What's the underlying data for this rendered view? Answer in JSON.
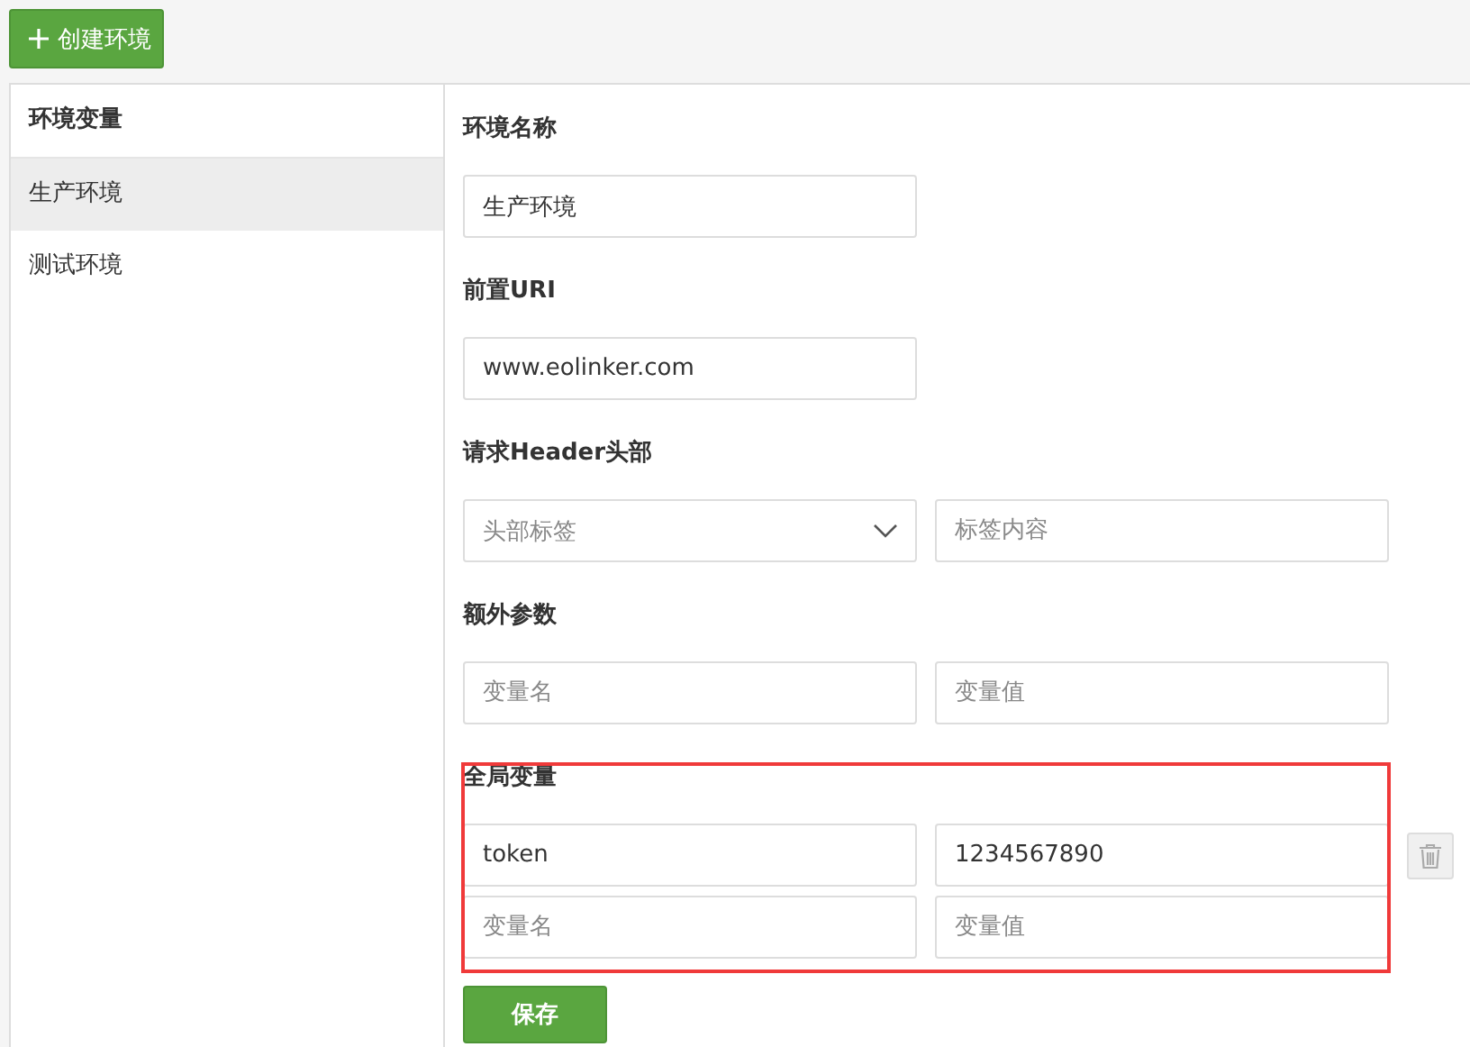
{
  "toolbar": {
    "create_button": "创建环境"
  },
  "sidebar": {
    "title": "环境变量",
    "items": [
      {
        "label": "生产环境",
        "selected": true
      },
      {
        "label": "测试环境",
        "selected": false
      }
    ]
  },
  "form": {
    "sections": [
      {
        "kind": "text",
        "label": "环境名称",
        "value": "生产环境"
      },
      {
        "kind": "text",
        "label": "前置URI",
        "value": "www.eolinker.com"
      },
      {
        "kind": "select-pair",
        "label": "请求Header头部",
        "select_placeholder": "头部标签",
        "placeholder": "标签内容"
      },
      {
        "kind": "pairs",
        "label": "额外参数",
        "highlighted": false,
        "rows": [
          {
            "name_placeholder": "变量名",
            "value_placeholder": "变量值",
            "deletable": false
          }
        ]
      },
      {
        "kind": "pairs",
        "label": "全局变量",
        "highlighted": true,
        "rows": [
          {
            "name": "token",
            "value": "1234567890",
            "deletable": true
          },
          {
            "name_placeholder": "变量名",
            "value_placeholder": "变量值",
            "deletable": false
          }
        ]
      }
    ],
    "save_button": "保存"
  }
}
